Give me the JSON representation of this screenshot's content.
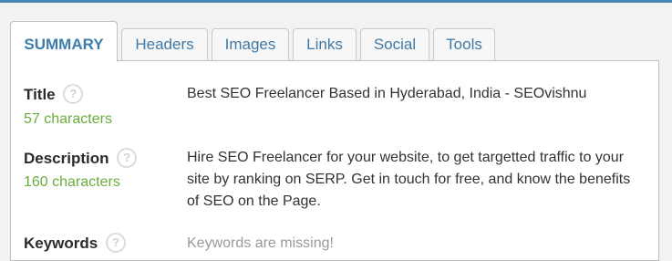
{
  "tabs": [
    {
      "label": "SUMMARY",
      "active": true
    },
    {
      "label": "Headers",
      "active": false
    },
    {
      "label": "Images",
      "active": false
    },
    {
      "label": "Links",
      "active": false
    },
    {
      "label": "Social",
      "active": false
    },
    {
      "label": "Tools",
      "active": false
    }
  ],
  "summary": {
    "title": {
      "label": "Title",
      "help": "?",
      "count": "57 characters",
      "value": "Best SEO Freelancer Based in Hyderabad, India - SEOvishnu"
    },
    "description": {
      "label": "Description",
      "help": "?",
      "count": "160 characters",
      "value": "Hire SEO Freelancer for your website, to get targetted traffic to your site by ranking on SERP. Get in touch for free, and know the benefits of SEO on the Page."
    },
    "keywords": {
      "label": "Keywords",
      "help": "?",
      "value": "Keywords are missing!"
    }
  },
  "colors": {
    "accent": "#4a86b1",
    "tab_text": "#3f7aa6",
    "count_green": "#6aad3d",
    "missing_gray": "#9a9a9a"
  }
}
